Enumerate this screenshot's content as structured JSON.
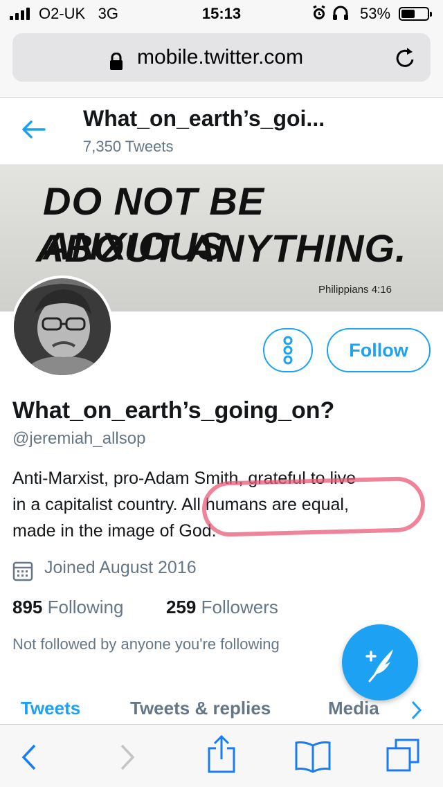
{
  "status_bar": {
    "carrier": "O2-UK",
    "network": "3G",
    "time": "15:13",
    "battery_percent": "53%",
    "battery_level": 0.53
  },
  "browser": {
    "url": "mobile.twitter.com",
    "icons": [
      "lock-icon",
      "reload-icon"
    ]
  },
  "header": {
    "title": "What_on_earth’s_goi...",
    "tweet_count": "7,350 Tweets"
  },
  "banner": {
    "line1": "DO NOT BE ANXIOUS",
    "line2": "ABOUT ANYTHING.",
    "reference": "Philippians 4:16"
  },
  "profile": {
    "display_name": "What_on_earth’s_going_on?",
    "handle": "@jeremiah_allsop",
    "bio_1": "Anti-Marxist, pro-Adam Smith, grateful to live",
    "bio_2": "in a capitalist country. All humans are equal,",
    "bio_3": "made in the image of God.",
    "joined": "Joined August 2016",
    "following_count": "895",
    "following_label": "Following",
    "followers_count": "259",
    "followers_label": "Followers",
    "not_followed": "Not followed by anyone you're following",
    "follow_label": "Follow"
  },
  "tabs": [
    "Tweets",
    "Tweets & replies",
    "Media"
  ],
  "colors": {
    "accent": "#1da1f2",
    "muted": "#657786",
    "highlight_circle": "#e95a78"
  }
}
